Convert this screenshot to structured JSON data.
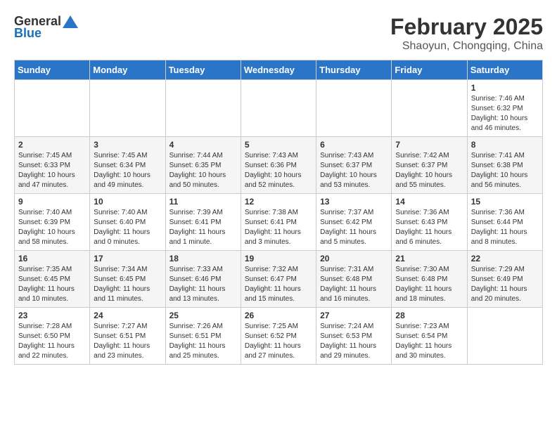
{
  "header": {
    "logo_general": "General",
    "logo_blue": "Blue",
    "title": "February 2025",
    "subtitle": "Shaoyun, Chongqing, China"
  },
  "weekdays": [
    "Sunday",
    "Monday",
    "Tuesday",
    "Wednesday",
    "Thursday",
    "Friday",
    "Saturday"
  ],
  "weeks": [
    [
      {
        "day": "",
        "info": ""
      },
      {
        "day": "",
        "info": ""
      },
      {
        "day": "",
        "info": ""
      },
      {
        "day": "",
        "info": ""
      },
      {
        "day": "",
        "info": ""
      },
      {
        "day": "",
        "info": ""
      },
      {
        "day": "1",
        "info": "Sunrise: 7:46 AM\nSunset: 6:32 PM\nDaylight: 10 hours and 46 minutes."
      }
    ],
    [
      {
        "day": "2",
        "info": "Sunrise: 7:45 AM\nSunset: 6:33 PM\nDaylight: 10 hours and 47 minutes."
      },
      {
        "day": "3",
        "info": "Sunrise: 7:45 AM\nSunset: 6:34 PM\nDaylight: 10 hours and 49 minutes."
      },
      {
        "day": "4",
        "info": "Sunrise: 7:44 AM\nSunset: 6:35 PM\nDaylight: 10 hours and 50 minutes."
      },
      {
        "day": "5",
        "info": "Sunrise: 7:43 AM\nSunset: 6:36 PM\nDaylight: 10 hours and 52 minutes."
      },
      {
        "day": "6",
        "info": "Sunrise: 7:43 AM\nSunset: 6:37 PM\nDaylight: 10 hours and 53 minutes."
      },
      {
        "day": "7",
        "info": "Sunrise: 7:42 AM\nSunset: 6:37 PM\nDaylight: 10 hours and 55 minutes."
      },
      {
        "day": "8",
        "info": "Sunrise: 7:41 AM\nSunset: 6:38 PM\nDaylight: 10 hours and 56 minutes."
      }
    ],
    [
      {
        "day": "9",
        "info": "Sunrise: 7:40 AM\nSunset: 6:39 PM\nDaylight: 10 hours and 58 minutes."
      },
      {
        "day": "10",
        "info": "Sunrise: 7:40 AM\nSunset: 6:40 PM\nDaylight: 11 hours and 0 minutes."
      },
      {
        "day": "11",
        "info": "Sunrise: 7:39 AM\nSunset: 6:41 PM\nDaylight: 11 hours and 1 minute."
      },
      {
        "day": "12",
        "info": "Sunrise: 7:38 AM\nSunset: 6:41 PM\nDaylight: 11 hours and 3 minutes."
      },
      {
        "day": "13",
        "info": "Sunrise: 7:37 AM\nSunset: 6:42 PM\nDaylight: 11 hours and 5 minutes."
      },
      {
        "day": "14",
        "info": "Sunrise: 7:36 AM\nSunset: 6:43 PM\nDaylight: 11 hours and 6 minutes."
      },
      {
        "day": "15",
        "info": "Sunrise: 7:36 AM\nSunset: 6:44 PM\nDaylight: 11 hours and 8 minutes."
      }
    ],
    [
      {
        "day": "16",
        "info": "Sunrise: 7:35 AM\nSunset: 6:45 PM\nDaylight: 11 hours and 10 minutes."
      },
      {
        "day": "17",
        "info": "Sunrise: 7:34 AM\nSunset: 6:45 PM\nDaylight: 11 hours and 11 minutes."
      },
      {
        "day": "18",
        "info": "Sunrise: 7:33 AM\nSunset: 6:46 PM\nDaylight: 11 hours and 13 minutes."
      },
      {
        "day": "19",
        "info": "Sunrise: 7:32 AM\nSunset: 6:47 PM\nDaylight: 11 hours and 15 minutes."
      },
      {
        "day": "20",
        "info": "Sunrise: 7:31 AM\nSunset: 6:48 PM\nDaylight: 11 hours and 16 minutes."
      },
      {
        "day": "21",
        "info": "Sunrise: 7:30 AM\nSunset: 6:48 PM\nDaylight: 11 hours and 18 minutes."
      },
      {
        "day": "22",
        "info": "Sunrise: 7:29 AM\nSunset: 6:49 PM\nDaylight: 11 hours and 20 minutes."
      }
    ],
    [
      {
        "day": "23",
        "info": "Sunrise: 7:28 AM\nSunset: 6:50 PM\nDaylight: 11 hours and 22 minutes."
      },
      {
        "day": "24",
        "info": "Sunrise: 7:27 AM\nSunset: 6:51 PM\nDaylight: 11 hours and 23 minutes."
      },
      {
        "day": "25",
        "info": "Sunrise: 7:26 AM\nSunset: 6:51 PM\nDaylight: 11 hours and 25 minutes."
      },
      {
        "day": "26",
        "info": "Sunrise: 7:25 AM\nSunset: 6:52 PM\nDaylight: 11 hours and 27 minutes."
      },
      {
        "day": "27",
        "info": "Sunrise: 7:24 AM\nSunset: 6:53 PM\nDaylight: 11 hours and 29 minutes."
      },
      {
        "day": "28",
        "info": "Sunrise: 7:23 AM\nSunset: 6:54 PM\nDaylight: 11 hours and 30 minutes."
      },
      {
        "day": "",
        "info": ""
      }
    ]
  ]
}
